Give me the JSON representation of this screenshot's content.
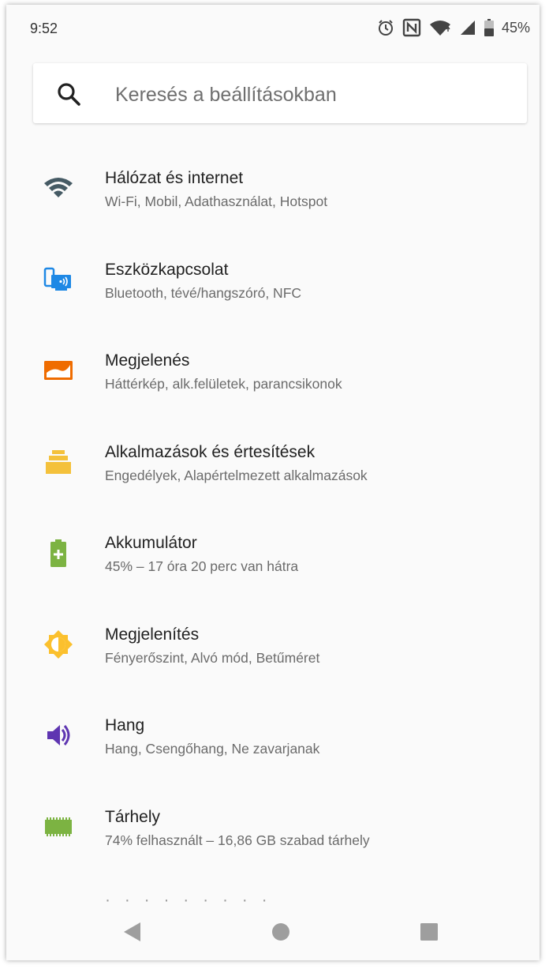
{
  "status_bar": {
    "time": "9:52",
    "icons": [
      "alarm-icon",
      "nfc-icon",
      "wifi-icon",
      "signal-icon",
      "battery-icon"
    ],
    "battery_percent": "45%"
  },
  "search": {
    "placeholder": "Keresés a beállításokban"
  },
  "settings": {
    "items": [
      {
        "title": "Hálózat és internet",
        "summary": "Wi-Fi, Mobil, Adathasználat, Hotspot",
        "icon": "wifi-icon",
        "color": "#455a64"
      },
      {
        "title": "Eszközkapcsolat",
        "summary": "Bluetooth, tévé/hangszóró, NFC",
        "icon": "connected-devices-icon",
        "color": "#1e88e5"
      },
      {
        "title": "Megjelenés",
        "summary": "Háttérkép, alk.felületek, parancsikonok",
        "icon": "wallpaper-icon",
        "color": "#ef6c00"
      },
      {
        "title": "Alkalmazások és értesítések",
        "summary": "Engedélyek, Alapértelmezett alkalmazások",
        "icon": "apps-icon",
        "color": "#f4c13b"
      },
      {
        "title": "Akkumulátor",
        "summary": "45% – 17 óra  20 perc van hátra",
        "icon": "battery-icon",
        "color": "#7cb342"
      },
      {
        "title": "Megjelenítés",
        "summary": "Fényerőszint, Alvó mód, Betűméret",
        "icon": "brightness-icon",
        "color": "#fbc02d"
      },
      {
        "title": "Hang",
        "summary": "Hang, Csengőhang, Ne zavarjanak",
        "icon": "volume-icon",
        "color": "#5e35b1"
      },
      {
        "title": "Tárhely",
        "summary": "74% felhasznált – 16,86 GB szabad tárhely",
        "icon": "storage-icon",
        "color": "#7cb342"
      }
    ]
  },
  "nav": {
    "buttons": [
      "back-icon",
      "home-icon",
      "recents-icon"
    ]
  }
}
